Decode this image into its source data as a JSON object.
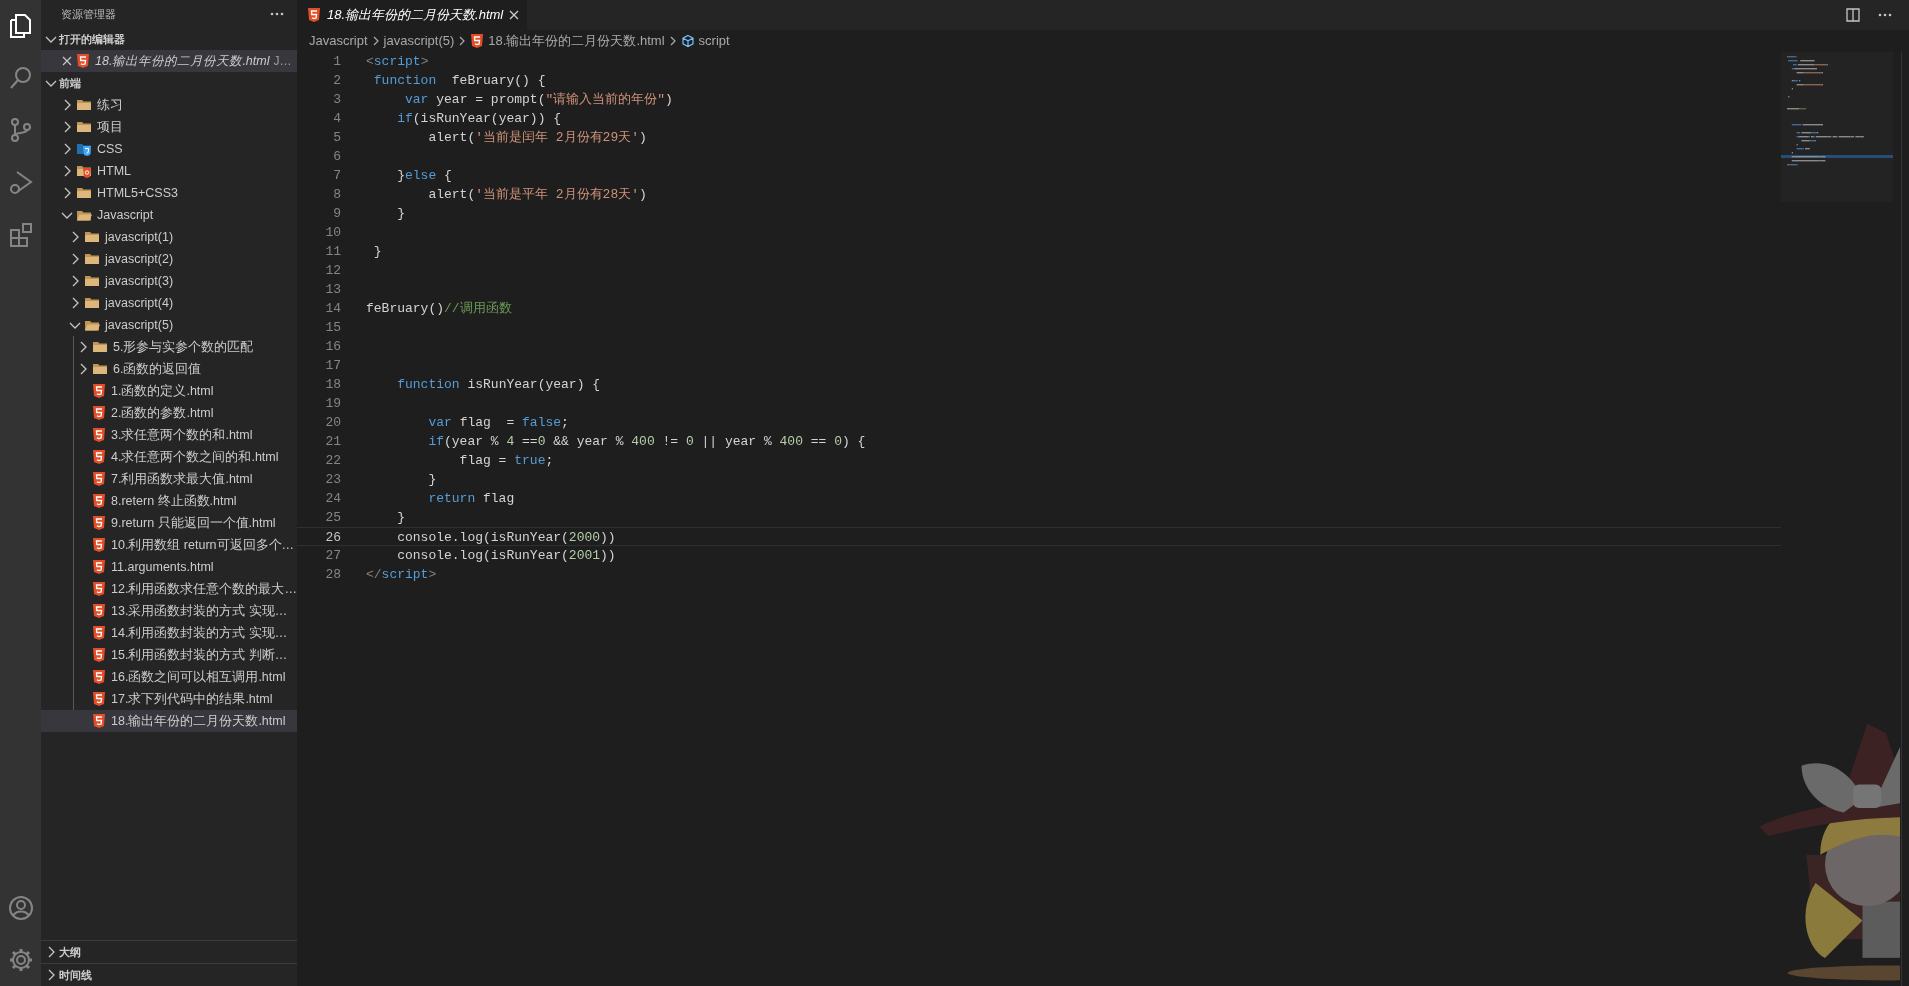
{
  "activity_bar": {
    "items": [
      {
        "kind": "explorer",
        "selected": true
      },
      {
        "kind": "search",
        "selected": false
      },
      {
        "kind": "source-control",
        "selected": false
      },
      {
        "kind": "run-debug",
        "selected": false
      },
      {
        "kind": "extensions",
        "selected": false
      }
    ],
    "bottom": [
      {
        "kind": "account"
      },
      {
        "kind": "settings"
      }
    ]
  },
  "sidebar": {
    "title": "资源管理器",
    "open_editors": {
      "label": "打开的编辑器",
      "expanded": true,
      "items": [
        {
          "name": "18.输出年份的二月份天数.html",
          "description": "J…",
          "kind": "html-file",
          "preview": true,
          "selected": true
        }
      ]
    },
    "folder": {
      "label": "前端",
      "expanded": true,
      "children": [
        {
          "name": "练习",
          "kind": "folder",
          "expanded": false
        },
        {
          "name": "项目",
          "kind": "folder",
          "expanded": false
        },
        {
          "name": "CSS",
          "kind": "css-folder",
          "expanded": false
        },
        {
          "name": "HTML",
          "kind": "html-folder",
          "expanded": false
        },
        {
          "name": "HTML5+CSS3",
          "kind": "folder",
          "expanded": false
        },
        {
          "name": "Javascript",
          "kind": "folder",
          "expanded": true,
          "children": [
            {
              "name": "javascript(1)",
              "kind": "folder",
              "expanded": false
            },
            {
              "name": "javascript(2)",
              "kind": "folder",
              "expanded": false
            },
            {
              "name": "javascript(3)",
              "kind": "folder",
              "expanded": false
            },
            {
              "name": "javascript(4)",
              "kind": "folder",
              "expanded": false
            },
            {
              "name": "javascript(5)",
              "kind": "folder",
              "expanded": true,
              "children": [
                {
                  "name": "5.形参与实参个数的匹配",
                  "kind": "folder",
                  "expanded": false
                },
                {
                  "name": "6.函数的返回值",
                  "kind": "folder",
                  "expanded": false
                },
                {
                  "name": "1.函数的定义.html",
                  "kind": "html-file",
                  "selected": false
                },
                {
                  "name": "2.函数的参数.html",
                  "kind": "html-file",
                  "selected": false
                },
                {
                  "name": "3.求任意两个数的和.html",
                  "kind": "html-file",
                  "selected": false
                },
                {
                  "name": "4.求任意两个数之间的和.html",
                  "kind": "html-file",
                  "selected": false
                },
                {
                  "name": "7.利用函数求最大值.html",
                  "kind": "html-file",
                  "selected": false
                },
                {
                  "name": "8.retern 终止函数.html",
                  "kind": "html-file",
                  "selected": false
                },
                {
                  "name": "9.return 只能返回一个值.html",
                  "kind": "html-file",
                  "selected": false
                },
                {
                  "name": "10.利用数组 return可返回多个…",
                  "kind": "html-file",
                  "selected": false
                },
                {
                  "name": "11.arguments.html",
                  "kind": "html-file",
                  "selected": false
                },
                {
                  "name": "12.利用函数求任意个数的最大…",
                  "kind": "html-file",
                  "selected": false
                },
                {
                  "name": "13.采用函数封装的方式 实现…",
                  "kind": "html-file",
                  "selected": false
                },
                {
                  "name": "14.利用函数封装的方式 实现…",
                  "kind": "html-file",
                  "selected": false
                },
                {
                  "name": "15.利用函数封装的方式 判断…",
                  "kind": "html-file",
                  "selected": false
                },
                {
                  "name": "16.函数之间可以相互调用.html",
                  "kind": "html-file",
                  "selected": false
                },
                {
                  "name": "17.求下列代码中的结果.html",
                  "kind": "html-file",
                  "selected": false
                },
                {
                  "name": "18.输出年份的二月份天数.html",
                  "kind": "html-file",
                  "selected": true
                }
              ]
            }
          ]
        }
      ]
    },
    "panels": [
      {
        "label": "大纲",
        "expanded": false
      },
      {
        "label": "时间线",
        "expanded": false
      }
    ]
  },
  "tabs": [
    {
      "label": "18.输出年份的二月份天数.html",
      "kind": "html-file",
      "preview": true,
      "selected": true
    }
  ],
  "breadcrumb": [
    {
      "label": "Javascript"
    },
    {
      "label": "javascript(5)"
    },
    {
      "label": "18.输出年份的二月份天数.html",
      "kind": "html-file"
    },
    {
      "label": "script",
      "kind": "symbol"
    }
  ],
  "editor": {
    "lines": [
      {
        "number": "1",
        "tokens": [
          {
            "kind": "punct",
            "text": "<"
          },
          {
            "kind": "tag",
            "text": "script"
          },
          {
            "kind": "punct",
            "text": ">"
          }
        ]
      },
      {
        "number": "2",
        "tokens": [
          {
            "kind": "keyword",
            "text": " function"
          },
          {
            "kind": "plain",
            "text": "  feBruary() {"
          }
        ]
      },
      {
        "number": "3",
        "tokens": [
          {
            "kind": "keyword",
            "text": "     var"
          },
          {
            "kind": "plain",
            "text": " year = prompt("
          },
          {
            "kind": "string",
            "text": "\"请输入当前的年份\""
          },
          {
            "kind": "plain",
            "text": ")"
          }
        ]
      },
      {
        "number": "4",
        "tokens": [
          {
            "kind": "keyword",
            "text": "    if"
          },
          {
            "kind": "plain",
            "text": "(isRunYear(year)) {"
          }
        ]
      },
      {
        "number": "5",
        "tokens": [
          {
            "kind": "plain",
            "text": "        alert("
          },
          {
            "kind": "string",
            "text": "'当前是闰年 2月份有29天'"
          },
          {
            "kind": "plain",
            "text": ")"
          }
        ]
      },
      {
        "number": "6"
      },
      {
        "number": "7",
        "tokens": [
          {
            "kind": "plain",
            "text": "    }"
          },
          {
            "kind": "keyword",
            "text": "else"
          },
          {
            "kind": "plain",
            "text": " {"
          }
        ]
      },
      {
        "number": "8",
        "tokens": [
          {
            "kind": "plain",
            "text": "        alert("
          },
          {
            "kind": "string",
            "text": "'当前是平年 2月份有28天'"
          },
          {
            "kind": "plain",
            "text": ")"
          }
        ]
      },
      {
        "number": "9",
        "tokens": [
          {
            "kind": "plain",
            "text": "    }"
          }
        ]
      },
      {
        "number": "10"
      },
      {
        "number": "11",
        "tokens": [
          {
            "kind": "plain",
            "text": " }"
          }
        ]
      },
      {
        "number": "12"
      },
      {
        "number": "13"
      },
      {
        "number": "14",
        "tokens": [
          {
            "kind": "plain",
            "text": "feBruary()"
          },
          {
            "kind": "comment",
            "text": "//调用函数"
          }
        ]
      },
      {
        "number": "15"
      },
      {
        "number": "16"
      },
      {
        "number": "17"
      },
      {
        "number": "18",
        "tokens": [
          {
            "kind": "keyword",
            "text": "    function"
          },
          {
            "kind": "plain",
            "text": " isRunYear(year) {"
          }
        ]
      },
      {
        "number": "19"
      },
      {
        "number": "20",
        "tokens": [
          {
            "kind": "keyword",
            "text": "        var"
          },
          {
            "kind": "plain",
            "text": " flag  = "
          },
          {
            "kind": "keyword",
            "text": "false"
          },
          {
            "kind": "plain",
            "text": ";"
          }
        ]
      },
      {
        "number": "21",
        "tokens": [
          {
            "kind": "keyword",
            "text": "        if"
          },
          {
            "kind": "plain",
            "text": "(year % "
          },
          {
            "kind": "number",
            "text": "4"
          },
          {
            "kind": "plain",
            "text": " =="
          },
          {
            "kind": "number",
            "text": "0"
          },
          {
            "kind": "plain",
            "text": " && year % "
          },
          {
            "kind": "number",
            "text": "400"
          },
          {
            "kind": "plain",
            "text": " != "
          },
          {
            "kind": "number",
            "text": "0"
          },
          {
            "kind": "plain",
            "text": " || year % "
          },
          {
            "kind": "number",
            "text": "400"
          },
          {
            "kind": "plain",
            "text": " == "
          },
          {
            "kind": "number",
            "text": "0"
          },
          {
            "kind": "plain",
            "text": ") {"
          }
        ]
      },
      {
        "number": "22",
        "tokens": [
          {
            "kind": "plain",
            "text": "            flag = "
          },
          {
            "kind": "keyword",
            "text": "true"
          },
          {
            "kind": "plain",
            "text": ";"
          }
        ]
      },
      {
        "number": "23",
        "tokens": [
          {
            "kind": "plain",
            "text": "        }"
          }
        ]
      },
      {
        "number": "24",
        "tokens": [
          {
            "kind": "keyword",
            "text": "        return"
          },
          {
            "kind": "plain",
            "text": " flag"
          }
        ]
      },
      {
        "number": "25",
        "tokens": [
          {
            "kind": "plain",
            "text": "    }"
          }
        ]
      },
      {
        "number": "26",
        "current": true,
        "tokens": [
          {
            "kind": "plain",
            "text": "    console.log(isRunYear("
          },
          {
            "kind": "number",
            "text": "2000"
          },
          {
            "kind": "plain",
            "text": "))"
          }
        ]
      },
      {
        "number": "27",
        "tokens": [
          {
            "kind": "plain",
            "text": "    console.log(isRunYear("
          },
          {
            "kind": "number",
            "text": "2001"
          },
          {
            "kind": "plain",
            "text": "))"
          }
        ]
      },
      {
        "number": "28",
        "tokens": [
          {
            "kind": "punct",
            "text": "</"
          },
          {
            "kind": "tag",
            "text": "script"
          },
          {
            "kind": "punct",
            "text": ">"
          }
        ]
      }
    ]
  }
}
